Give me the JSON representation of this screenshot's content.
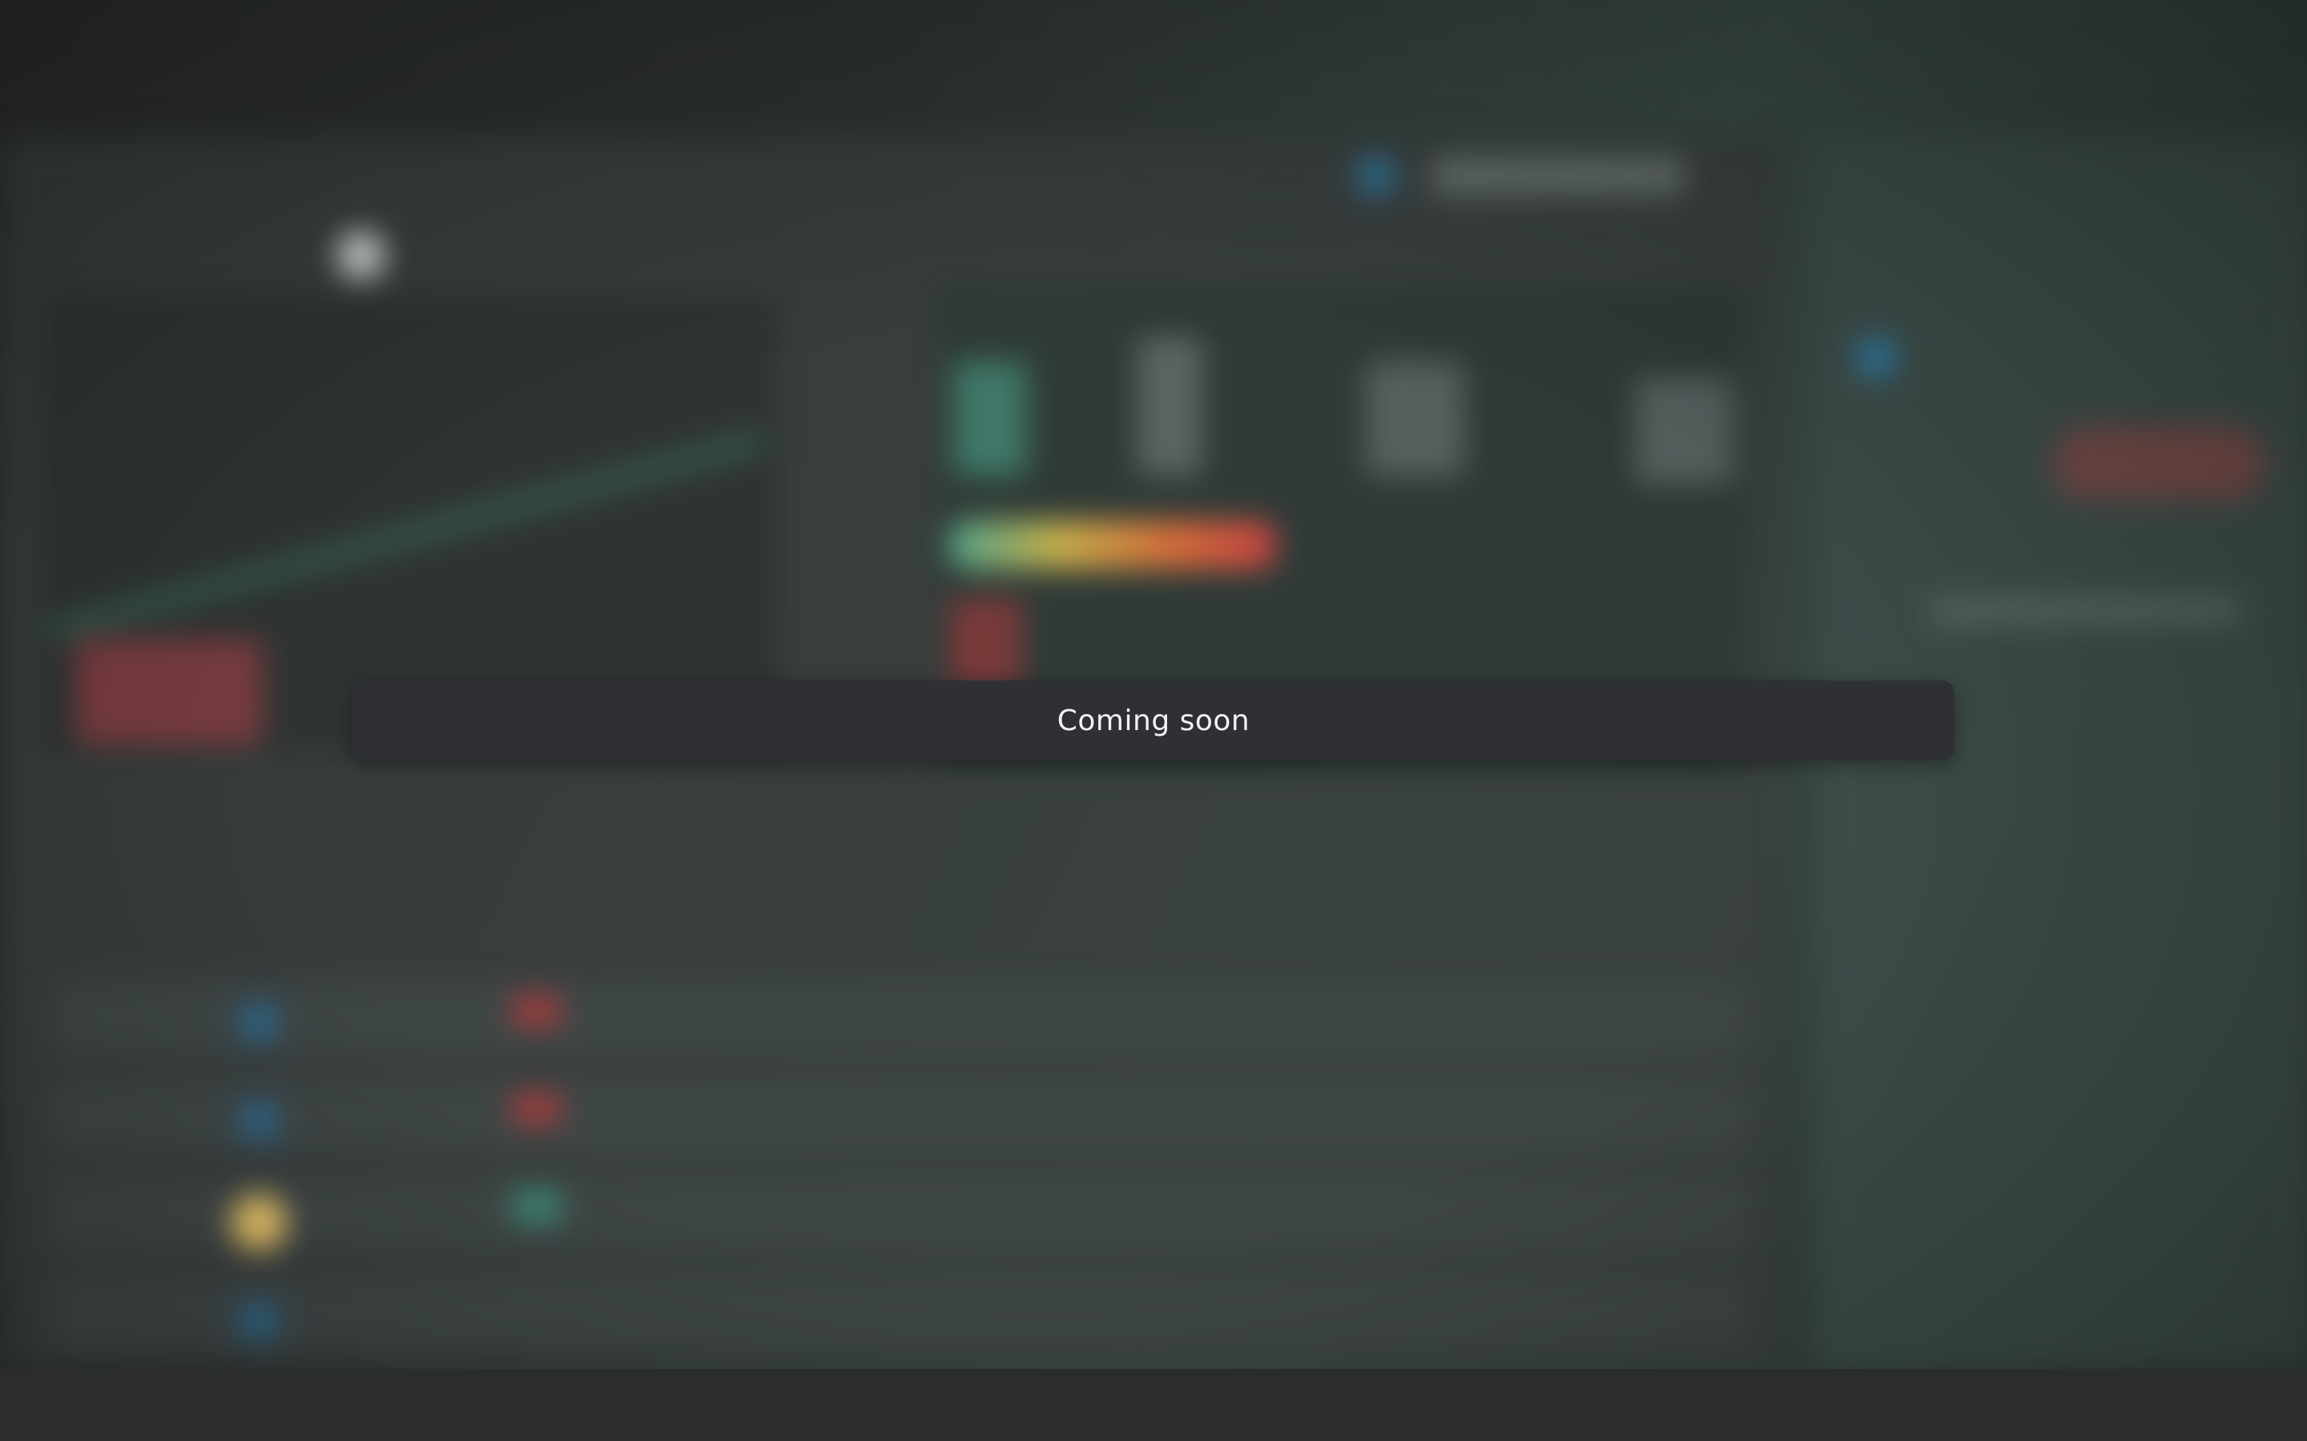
{
  "overlay": {
    "message": "Coming soon"
  },
  "colors": {
    "toast_background": "#2e3034",
    "toast_text": "#f2f2f2",
    "chart_up": "#3f8a70",
    "chart_down": "#a03c3c",
    "accent_blue": "#2f7ea8"
  }
}
